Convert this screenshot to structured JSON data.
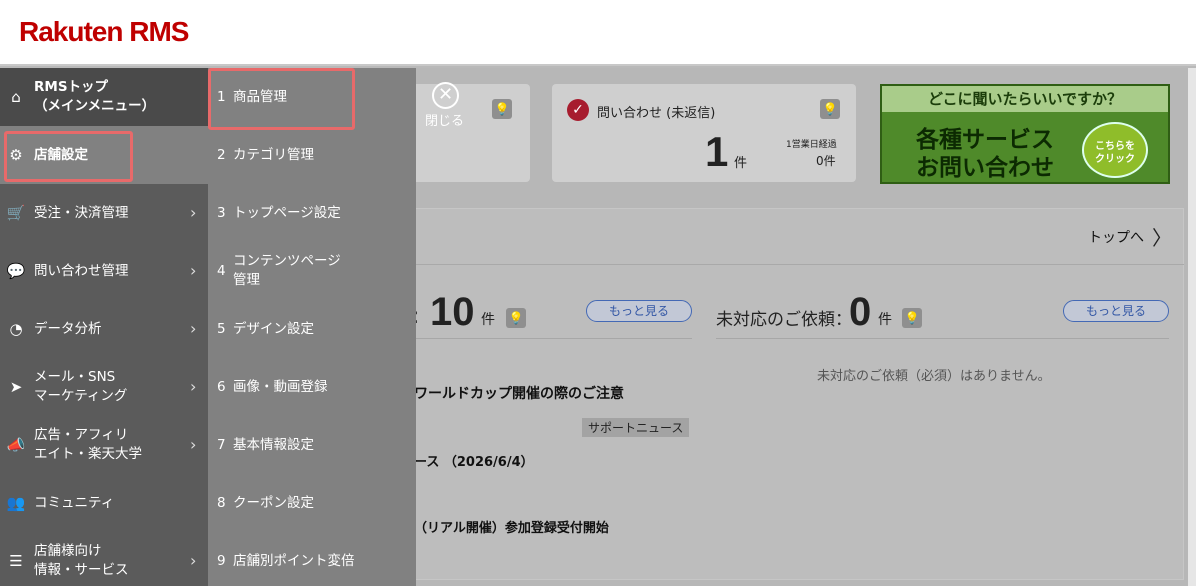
{
  "header": {
    "logo": "Rakuten RMS"
  },
  "sidebar": {
    "items": [
      {
        "label": "RMSトップ\n（メインメニュー）",
        "icon": "home-icon",
        "chevron": ""
      },
      {
        "label": "店舗設定",
        "icon": "gear-icon",
        "chevron": ""
      },
      {
        "label": "受注・決済管理",
        "icon": "cart-icon",
        "chevron": "›"
      },
      {
        "label": "問い合わせ管理",
        "icon": "chat-icon",
        "chevron": "›"
      },
      {
        "label": "データ分析",
        "icon": "pie-chart-icon",
        "chevron": "›"
      },
      {
        "label": "メール・SNS\nマーケティング",
        "icon": "paper-plane-icon",
        "chevron": "›"
      },
      {
        "label": "広告・アフィリ\nエイト・楽天大学",
        "icon": "megaphone-icon",
        "chevron": "›"
      },
      {
        "label": "コミュニティ",
        "icon": "users-icon",
        "chevron": ""
      },
      {
        "label": "店舗様向け\n情報・サービス",
        "icon": "info-list-icon",
        "chevron": "›"
      }
    ]
  },
  "submenu": {
    "items": [
      {
        "num": "1",
        "label": "商品管理"
      },
      {
        "num": "2",
        "label": "カテゴリ管理"
      },
      {
        "num": "3",
        "label": "トップページ設定"
      },
      {
        "num": "4",
        "label": "コンテンツページ\n管理"
      },
      {
        "num": "5",
        "label": "デザイン設定"
      },
      {
        "num": "6",
        "label": "画像・動画登録"
      },
      {
        "num": "7",
        "label": "基本情報設定"
      },
      {
        "num": "8",
        "label": "クーポン設定"
      },
      {
        "num": "9",
        "label": "店舗別ポイント変倍"
      }
    ]
  },
  "overlay": {
    "close_label": "閉じる",
    "close_glyph": "✕"
  },
  "inquiry": {
    "title": "問い合わせ (未返信)",
    "count": "1",
    "unit": "件",
    "sub_label": "1営業日経過",
    "sub_value": "0件"
  },
  "ad": {
    "top": "どこに聞いたらいいですか？",
    "line1": "各種サービス",
    "line2": "お問い合わせ",
    "click": "こちらを\nクリック"
  },
  "panel": {
    "top_link": "トップへ",
    "top_chevron": "〉",
    "colon": ":",
    "count_left": "10",
    "unit_left": "件",
    "more_left": "もっと見る",
    "pending_label": "未対応のご依頼：",
    "count_right": "0",
    "unit_right": "件",
    "more_right": "もっと見る",
    "pending_empty": "未対応のご依頼（必須）はありません。",
    "news1": "ワールドカップ開催の際のご注意",
    "badge": "サポートニュース",
    "news2": "ース （2026/6/4）",
    "news3": "（リアル開催）参加登録受付開始"
  }
}
